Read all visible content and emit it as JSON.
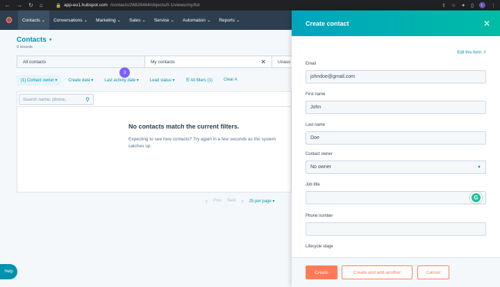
{
  "browser": {
    "url_host": "app-eu1.hubspot.com",
    "url_path": "/contacts/26828464/objects/0-1/views/my/list",
    "avatar_letter": "L"
  },
  "topnav": {
    "items": [
      {
        "label": "Contacts"
      },
      {
        "label": "Conversations"
      },
      {
        "label": "Marketing"
      },
      {
        "label": "Sales"
      },
      {
        "label": "Service"
      },
      {
        "label": "Automation"
      },
      {
        "label": "Reports"
      }
    ]
  },
  "page": {
    "title": "Contacts",
    "record_count": "0 records"
  },
  "views": {
    "tab1": "All contacts",
    "tab2": "My contacts",
    "tab3": "Unass"
  },
  "filters": {
    "contact_owner": "(1) Contact owner",
    "create_date": "Create date",
    "last_activity": "Last activity date",
    "lead_status": "Lead status",
    "all_filters": "All filters (1)",
    "clear": "Clear A",
    "badge": "3"
  },
  "table": {
    "search_placeholder": "Search name, phone,",
    "empty_title": "No contacts match the current filters.",
    "empty_text": "Expecting to see new contacts? Try again in a few seconds as the system catches up."
  },
  "pager": {
    "prev": "Prev",
    "next": "Next",
    "per_page": "25 per page"
  },
  "help_label": "Help",
  "panel": {
    "title": "Create contact",
    "edit_form": "Edit this form",
    "fields": {
      "email_label": "Email",
      "email_value": "johndoe@gmail.com",
      "first_name_label": "First name",
      "first_name_value": "John",
      "last_name_label": "Last name",
      "last_name_value": "Doe",
      "owner_label": "Contact owner",
      "owner_value": "No owner",
      "job_title_label": "Job title",
      "phone_label": "Phone number",
      "lifecycle_label": "Lifecycle stage"
    },
    "buttons": {
      "create": "Create",
      "create_another": "Create and add another",
      "cancel": "Cancel"
    }
  },
  "colors": {
    "nav_bg": "#2d3e50",
    "accent": "#0091ae",
    "orange": "#ff7a59",
    "panel_header_start": "#00a4bd",
    "panel_header_end": "#00bda5"
  }
}
